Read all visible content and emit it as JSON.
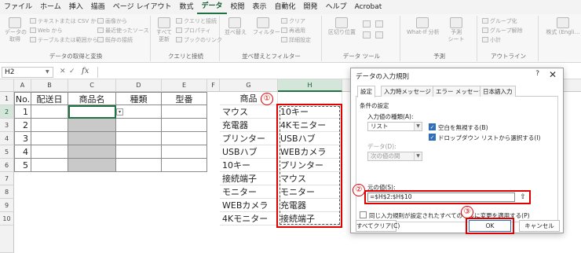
{
  "menu": {
    "items": [
      "ファイル",
      "ホーム",
      "挿入",
      "描画",
      "ページ レイアウト",
      "数式",
      "データ",
      "校閲",
      "表示",
      "自動化",
      "開発",
      "ヘルプ",
      "Acrobat"
    ],
    "active_index": 6
  },
  "ribbon": {
    "get_data": {
      "label": "データの取得と変換",
      "big_button": "データの\n取得",
      "small_buttons": [
        "テキストまたは CSV から",
        "Web から",
        "テーブルまたは範囲から",
        "画像から",
        "最近使ったソース",
        "既存の接続"
      ]
    },
    "queries": {
      "label": "クエリと接続",
      "big_button": "すべて\n更新",
      "small_buttons": [
        "クエリと接続",
        "プロパティ",
        "ブックのリンク"
      ]
    },
    "sort_filter": {
      "label": "並べ替えとフィルター",
      "big_buttons": [
        "並べ替え",
        "フィルター"
      ],
      "small_buttons": [
        "クリア",
        "再適用",
        "詳細設定"
      ]
    },
    "data_tools": {
      "label": "データ ツール",
      "big_buttons": [
        "区切り位置"
      ]
    },
    "forecast": {
      "label": "予測",
      "big_buttons": [
        "What-If 分析",
        "予測\nシート"
      ]
    },
    "outline": {
      "label": "アウトライン",
      "small_buttons": [
        "グループ化",
        "グループ解除",
        "小計"
      ]
    },
    "stocks": {
      "big_button": "株式 (Engli…"
    }
  },
  "formula_bar": {
    "name_box": "H2",
    "fx": "fx",
    "value": ""
  },
  "sheet": {
    "columns": [
      "A",
      "B",
      "C",
      "D",
      "E",
      "F",
      "G",
      "H"
    ],
    "rows": [
      "1",
      "2",
      "3",
      "4",
      "5",
      "6",
      "7",
      "8",
      "9",
      "10"
    ],
    "table_headers": [
      "No.",
      "配送日",
      "商品名",
      "種類",
      "型番"
    ],
    "numbers": [
      "1",
      "2",
      "3",
      "4",
      "5"
    ],
    "g_label": "商品",
    "g_items": [
      "マウス",
      "充電器",
      "プリンター",
      "USBハブ",
      "10キー",
      "接続端子",
      "モニター",
      "WEBカメラ",
      "4Kモニター"
    ],
    "h_items": [
      "10キー",
      "4Kモニター",
      "USBハブ",
      "WEBカメラ",
      "プリンター",
      "マウス",
      "モニター",
      "充電器",
      "接続端子"
    ],
    "dropdown_glyph": "▾"
  },
  "markers": {
    "one": "①",
    "two": "②",
    "three": "③",
    "color": "#e10000"
  },
  "dialog": {
    "title": "データの入力規則",
    "help": "?",
    "close": "✕",
    "tabs": [
      "設定",
      "入力時メッセージ",
      "エラー メッセージ",
      "日本語入力"
    ],
    "section": "条件の設定",
    "allow_label": "入力値の種類(A):",
    "allow_value": "リスト",
    "ignore_blank": "空白を無視する(B)",
    "in_cell_dropdown": "ドロップダウン リストから選択する(I)",
    "data_label": "データ(D):",
    "data_value": "次の値の間",
    "source_label": "元の値(S):",
    "source_value": "=$H$2:$H$10",
    "apply_all": "同じ入力規則が設定されたすべてのセルに変更を適用する(P)",
    "clear_all": "すべてクリア(C)",
    "ok": "OK",
    "cancel": "キャンセル"
  }
}
